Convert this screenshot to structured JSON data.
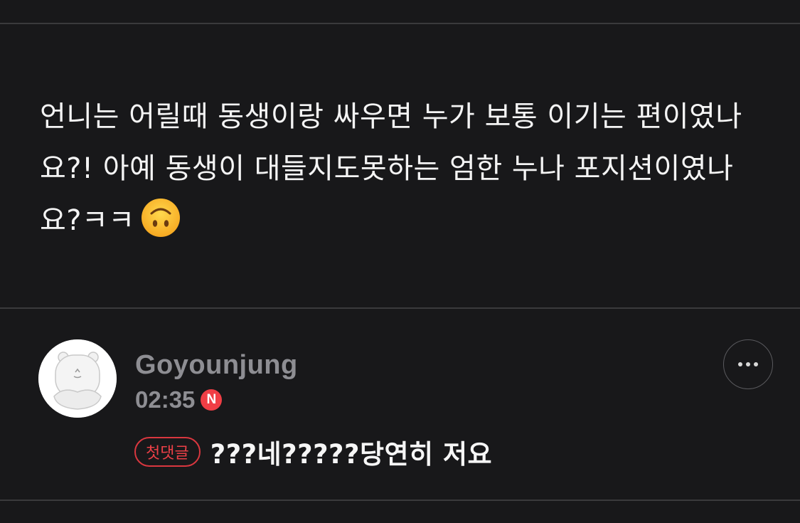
{
  "question": {
    "text": "언니는 어릴때 동생이랑 싸우면 누가 보통 이기는 편이였나요?! 아예 동생이 대들지도못하는 엄한 누나 포지션이였나요?ㅋㅋ",
    "emoji": "upside-down-face-emoji"
  },
  "comment": {
    "username": "Goyounjung",
    "time": "02:35",
    "new_badge": "N",
    "first_comment_label": "첫댓글",
    "text": "???네?????당연히 저요",
    "avatar": "bear-character-avatar",
    "more_icon": "more-options-icon"
  },
  "colors": {
    "background": "#18181a",
    "divider": "#3a3a3c",
    "muted_text": "#8e8e93",
    "accent_red": "#f03e45"
  }
}
